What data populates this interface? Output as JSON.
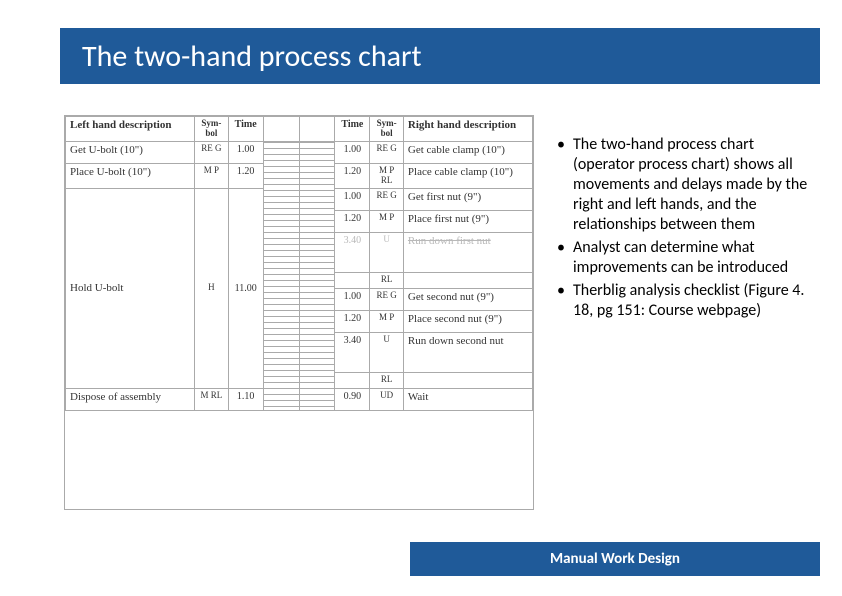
{
  "title": "The two-hand process chart",
  "footer": "Manual Work Design",
  "bullets": [
    "The two-hand process chart (operator process chart) shows all movements and delays made by the right and left hands, and the relationships between them",
    "Analyst can determine what improvements can be introduced",
    "Therblig analysis checklist (Figure 4. 18, pg 151: Course webpage)"
  ],
  "chart_data": {
    "type": "table",
    "headers": {
      "left_desc": "Left hand description",
      "left_sym": "Sym-bol",
      "left_time": "Time",
      "right_time": "Time",
      "right_sym": "Sym-bol",
      "right_desc": "Right hand description"
    },
    "left_rows": [
      {
        "desc": "Get U-bolt (10\")",
        "sym": "RE G",
        "time": "1.00"
      },
      {
        "desc": "Place U-bolt (10\")",
        "sym": "M P",
        "time": "1.20"
      },
      {
        "desc": "Hold U-bolt",
        "sym": "H",
        "time": "11.00"
      },
      {
        "desc": "Dispose of assembly",
        "sym": "M RL",
        "time": "1.10"
      }
    ],
    "right_rows": [
      {
        "time": "1.00",
        "sym": "RE G",
        "desc": "Get cable clamp (10\")"
      },
      {
        "time": "1.20",
        "sym": "M P RL",
        "desc": "Place cable clamp (10\")"
      },
      {
        "time": "1.00",
        "sym": "RE G",
        "desc": "Get first nut (9\")"
      },
      {
        "time": "1.20",
        "sym": "M P",
        "desc": "Place first nut (9\")"
      },
      {
        "time": "3.40",
        "sym": "U",
        "desc": "Run down first nut",
        "faded": true
      },
      {
        "time": "",
        "sym": "RL",
        "desc": ""
      },
      {
        "time": "1.00",
        "sym": "RE G",
        "desc": "Get second nut (9\")"
      },
      {
        "time": "1.20",
        "sym": "M P",
        "desc": "Place second nut (9\")"
      },
      {
        "time": "3.40",
        "sym": "U",
        "desc": "Run down second nut"
      },
      {
        "time": "",
        "sym": "RL",
        "desc": ""
      },
      {
        "time": "0.90",
        "sym": "UD",
        "desc": "Wait"
      }
    ]
  }
}
